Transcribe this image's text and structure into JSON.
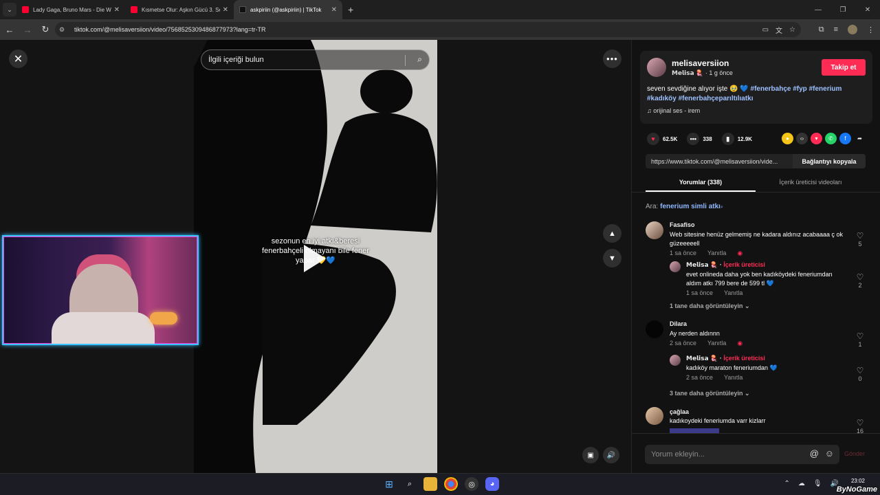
{
  "browser": {
    "tabs": [
      {
        "title": "Lady Gaga, Bruno Mars - Die W",
        "icon": "youtube-icon"
      },
      {
        "title": "Kısmetse Olur: Aşkın Gücü 3. Se",
        "icon": "youtube-icon"
      },
      {
        "title": "askpiriin (@askpiriin) | TikTok",
        "icon": "tiktok-icon",
        "active": true
      }
    ],
    "url": "tiktok.com/@melisaversiion/video/7568525309486877973?lang=tr-TR"
  },
  "video": {
    "search_placeholder": "İlgili içeriği bulun",
    "caption": "sezonun en iyi atkı&beresi fenerbahçeli olmayanı bile fener yapar 💛💙"
  },
  "post": {
    "username": "melisaversiion",
    "subline": "𝗠𝗲𝗹𝗶𝘀𝗮 🪼 · 1 g önce",
    "follow_label": "Takip et",
    "desc_text": "seven sevdiğine alıyor işte 🥹 💙",
    "hashtags": "#fenerbahçe #fyp #fenerium #kadıköy #fenerbahçeparıltılıatkı",
    "music": "orijinal ses - irem",
    "likes": "62.5K",
    "comments": "338",
    "saves": "12.9K",
    "link": "https://www.tiktok.com/@melisaversiion/vide...",
    "copy_label": "Bağlantıyı kopyala"
  },
  "panel_tabs": [
    "Yorumlar (338)",
    "İçerik üreticisi videoları"
  ],
  "search_hint": {
    "prefix": "Ara:",
    "term": "fenerium simli atkı"
  },
  "comments": [
    {
      "user": "Fasafiso",
      "text": "Web sitesine henüz gelmemiş ne kadara aldınız acabaaaa ç ok güzeeeeell",
      "time": "1 sa önce",
      "reply": "Yanıtla",
      "likes": "5"
    },
    {
      "user": "𝗠𝗲𝗹𝗶𝘀𝗮 🪼",
      "badge": "İçerik üreticisi",
      "text": "evet onlineda daha yok ben kadıköydeki feneriumdan aldım atkı 799 bere de 599 tl 💙",
      "time": "1 sa önce",
      "reply": "Yanıtla",
      "likes": "2"
    },
    {
      "user": "Dilara",
      "text": "Ay nerden aldınnn",
      "time": "2 sa önce",
      "reply": "Yanıtla",
      "likes": "1"
    },
    {
      "user": "𝗠𝗲𝗹𝗶𝘀𝗮 🪼",
      "badge": "İçerik üreticisi",
      "text": "kadıköy maraton feneriumdan 💙",
      "time": "2 sa önce",
      "reply": "Yanıtla",
      "likes": "0"
    },
    {
      "user": "çağlaa",
      "text": "kadıkoydeki feneriumda varr kizlarr",
      "likes": "16"
    }
  ],
  "more_replies": [
    "1 tane daha görüntüleyin",
    "3 tane daha görüntüleyin"
  ],
  "input": {
    "placeholder": "Yorum ekleyin...",
    "send": "Gönder"
  },
  "taskbar": {
    "time": "23:02",
    "watermark": "ByNoGame"
  },
  "colors": {
    "accent": "#fe2c55",
    "hashtag": "#9ec1ff",
    "neon": "#39c4ff"
  }
}
